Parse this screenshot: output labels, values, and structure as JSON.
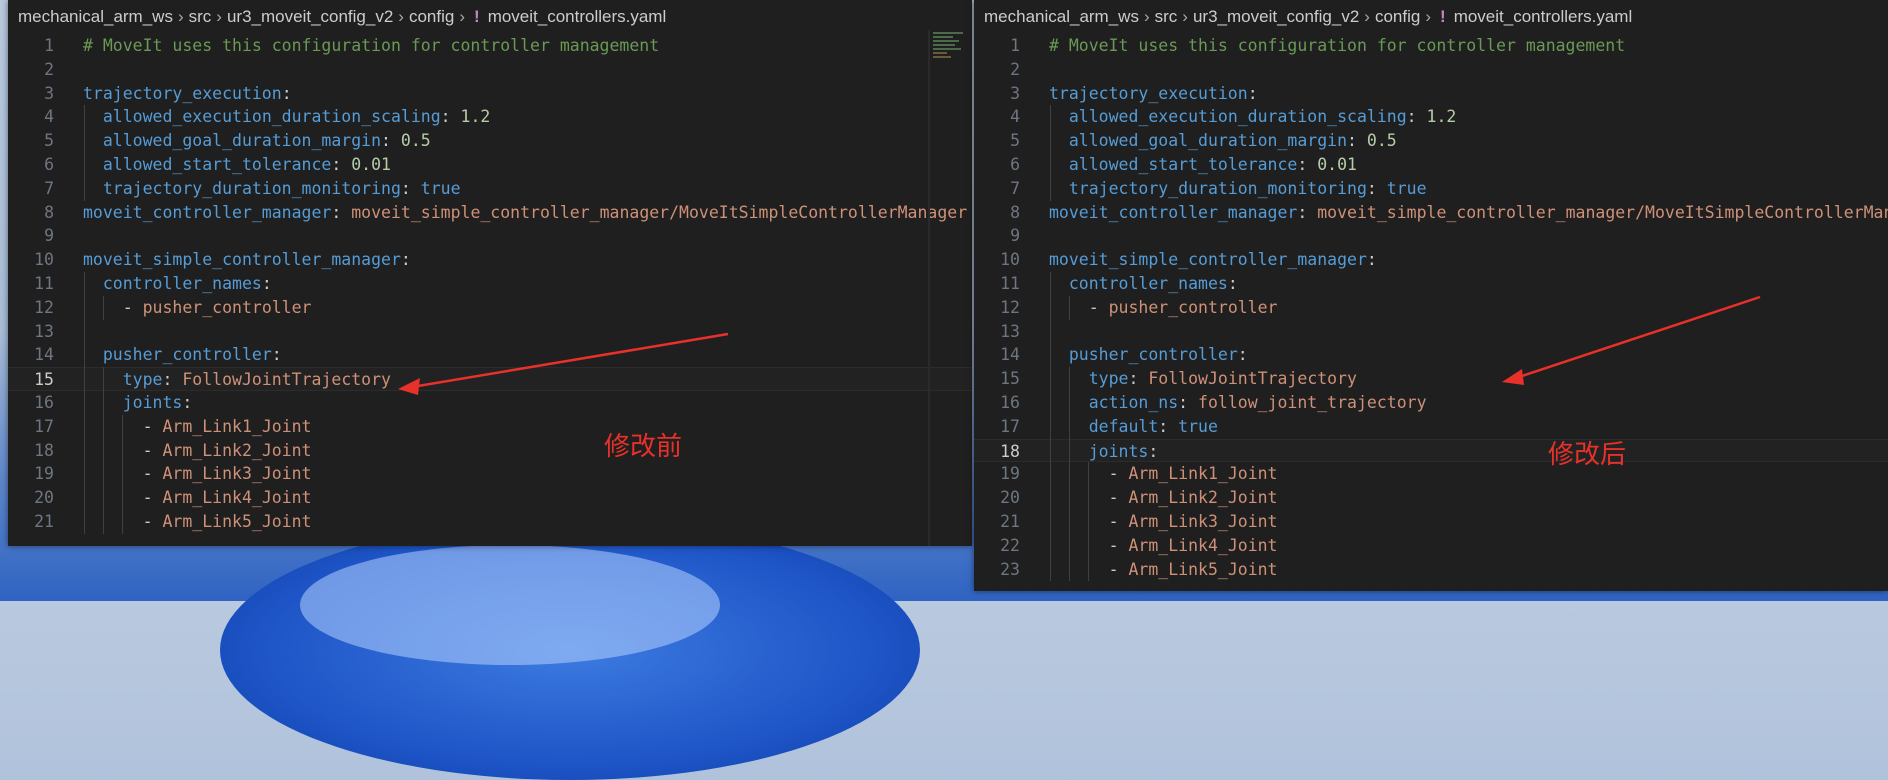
{
  "breadcrumb": [
    "mechanical_arm_ws",
    "src",
    "ur3_moveit_config_v2",
    "config",
    "!",
    "moveit_controllers.yaml"
  ],
  "left": {
    "annotation": "修改前",
    "current_line": 15,
    "lines": [
      [
        [
          "c",
          "# MoveIt uses this configuration for controller management"
        ]
      ],
      [],
      [
        [
          "k",
          "trajectory_execution"
        ],
        [
          "p",
          ":"
        ]
      ],
      [
        [
          "p",
          "  "
        ],
        [
          "k",
          "allowed_execution_duration_scaling"
        ],
        [
          "p",
          ": "
        ],
        [
          "n",
          "1.2"
        ]
      ],
      [
        [
          "p",
          "  "
        ],
        [
          "k",
          "allowed_goal_duration_margin"
        ],
        [
          "p",
          ": "
        ],
        [
          "n",
          "0.5"
        ]
      ],
      [
        [
          "p",
          "  "
        ],
        [
          "k",
          "allowed_start_tolerance"
        ],
        [
          "p",
          ": "
        ],
        [
          "n",
          "0.01"
        ]
      ],
      [
        [
          "p",
          "  "
        ],
        [
          "k",
          "trajectory_duration_monitoring"
        ],
        [
          "p",
          ": "
        ],
        [
          "k",
          "true"
        ]
      ],
      [
        [
          "k",
          "moveit_controller_manager"
        ],
        [
          "p",
          ": "
        ],
        [
          "s",
          "moveit_simple_controller_manager/MoveItSimpleControllerManager"
        ]
      ],
      [],
      [
        [
          "k",
          "moveit_simple_controller_manager"
        ],
        [
          "p",
          ":"
        ]
      ],
      [
        [
          "p",
          "  "
        ],
        [
          "k",
          "controller_names"
        ],
        [
          "p",
          ":"
        ]
      ],
      [
        [
          "p",
          "    - "
        ],
        [
          "s",
          "pusher_controller"
        ]
      ],
      [],
      [
        [
          "p",
          "  "
        ],
        [
          "k",
          "pusher_controller"
        ],
        [
          "p",
          ":"
        ]
      ],
      [
        [
          "p",
          "    "
        ],
        [
          "k",
          "type"
        ],
        [
          "p",
          ": "
        ],
        [
          "s",
          "FollowJointTrajectory"
        ]
      ],
      [
        [
          "p",
          "    "
        ],
        [
          "k",
          "joints"
        ],
        [
          "p",
          ":"
        ]
      ],
      [
        [
          "p",
          "      - "
        ],
        [
          "s",
          "Arm_Link1_Joint"
        ]
      ],
      [
        [
          "p",
          "      - "
        ],
        [
          "s",
          "Arm_Link2_Joint"
        ]
      ],
      [
        [
          "p",
          "      - "
        ],
        [
          "s",
          "Arm_Link3_Joint"
        ]
      ],
      [
        [
          "p",
          "      - "
        ],
        [
          "s",
          "Arm_Link4_Joint"
        ]
      ],
      [
        [
          "p",
          "      - "
        ],
        [
          "s",
          "Arm_Link5_Joint"
        ]
      ]
    ]
  },
  "right": {
    "annotation": "修改后",
    "current_line": 18,
    "lines": [
      [
        [
          "c",
          "# MoveIt uses this configuration for controller management"
        ]
      ],
      [],
      [
        [
          "k",
          "trajectory_execution"
        ],
        [
          "p",
          ":"
        ]
      ],
      [
        [
          "p",
          "  "
        ],
        [
          "k",
          "allowed_execution_duration_scaling"
        ],
        [
          "p",
          ": "
        ],
        [
          "n",
          "1.2"
        ]
      ],
      [
        [
          "p",
          "  "
        ],
        [
          "k",
          "allowed_goal_duration_margin"
        ],
        [
          "p",
          ": "
        ],
        [
          "n",
          "0.5"
        ]
      ],
      [
        [
          "p",
          "  "
        ],
        [
          "k",
          "allowed_start_tolerance"
        ],
        [
          "p",
          ": "
        ],
        [
          "n",
          "0.01"
        ]
      ],
      [
        [
          "p",
          "  "
        ],
        [
          "k",
          "trajectory_duration_monitoring"
        ],
        [
          "p",
          ": "
        ],
        [
          "k",
          "true"
        ]
      ],
      [
        [
          "k",
          "moveit_controller_manager"
        ],
        [
          "p",
          ": "
        ],
        [
          "s",
          "moveit_simple_controller_manager/MoveItSimpleControllerManager"
        ]
      ],
      [],
      [
        [
          "k",
          "moveit_simple_controller_manager"
        ],
        [
          "p",
          ":"
        ]
      ],
      [
        [
          "p",
          "  "
        ],
        [
          "k",
          "controller_names"
        ],
        [
          "p",
          ":"
        ]
      ],
      [
        [
          "p",
          "    - "
        ],
        [
          "s",
          "pusher_controller"
        ]
      ],
      [],
      [
        [
          "p",
          "  "
        ],
        [
          "k",
          "pusher_controller"
        ],
        [
          "p",
          ":"
        ]
      ],
      [
        [
          "p",
          "    "
        ],
        [
          "k",
          "type"
        ],
        [
          "p",
          ": "
        ],
        [
          "s",
          "FollowJointTrajectory"
        ]
      ],
      [
        [
          "p",
          "    "
        ],
        [
          "k",
          "action_ns"
        ],
        [
          "p",
          ": "
        ],
        [
          "s",
          "follow_joint_trajectory"
        ]
      ],
      [
        [
          "p",
          "    "
        ],
        [
          "k",
          "default"
        ],
        [
          "p",
          ": "
        ],
        [
          "k",
          "true"
        ]
      ],
      [
        [
          "p",
          "    "
        ],
        [
          "k",
          "joints"
        ],
        [
          "p",
          ":"
        ]
      ],
      [
        [
          "p",
          "      - "
        ],
        [
          "s",
          "Arm_Link1_Joint"
        ]
      ],
      [
        [
          "p",
          "      - "
        ],
        [
          "s",
          "Arm_Link2_Joint"
        ]
      ],
      [
        [
          "p",
          "      - "
        ],
        [
          "s",
          "Arm_Link3_Joint"
        ]
      ],
      [
        [
          "p",
          "      - "
        ],
        [
          "s",
          "Arm_Link4_Joint"
        ]
      ],
      [
        [
          "p",
          "      - "
        ],
        [
          "s",
          "Arm_Link5_Joint"
        ]
      ]
    ]
  }
}
